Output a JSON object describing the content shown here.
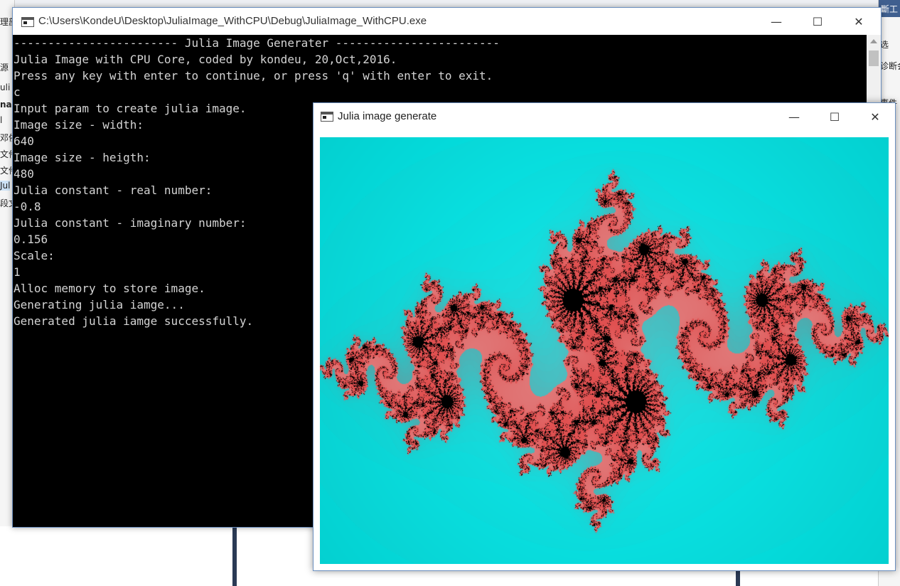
{
  "console_window": {
    "title": "C:\\Users\\KondeU\\Desktop\\JuliaImage_WithCPU\\Debug\\JuliaImage_WithCPU.exe",
    "controls": {
      "minimize": "—",
      "maximize": "☐",
      "close": "✕"
    },
    "lines": [
      "------------------------ Julia Image Generater ------------------------",
      "Julia Image with CPU Core, coded by kondeu, 20,Oct,2016.",
      "Press any key with enter to continue, or press 'q' with enter to exit.",
      "c",
      "Input param to create julia image.",
      "Image size - width:",
      "640",
      "Image size - heigth:",
      "480",
      "Julia constant - real number:",
      "-0.8",
      "Julia constant - imaginary number:",
      "0.156",
      "Scale:",
      "1",
      "Alloc memory to store image.",
      "Generating julia iamge...",
      "Generated julia iamge successfully."
    ]
  },
  "julia_window": {
    "title": "Julia image generate",
    "controls": {
      "minimize": "—",
      "maximize": "☐",
      "close": "✕"
    },
    "image": {
      "julia_constant_real": -0.8,
      "julia_constant_imag": 0.156,
      "scale": 1,
      "background_color": "#00f8f8",
      "fractal_color": "#e06060",
      "core_color": "#000000"
    }
  },
  "background_fragments": {
    "left": [
      "理部",
      "源",
      "uli",
      "na",
      "l",
      "邓依",
      "文件",
      "文件",
      "Jul",
      "段文"
    ],
    "right": [
      "斷工",
      "选",
      "诊断会",
      "事件",
      "宴",
      "U",
      "等"
    ]
  }
}
